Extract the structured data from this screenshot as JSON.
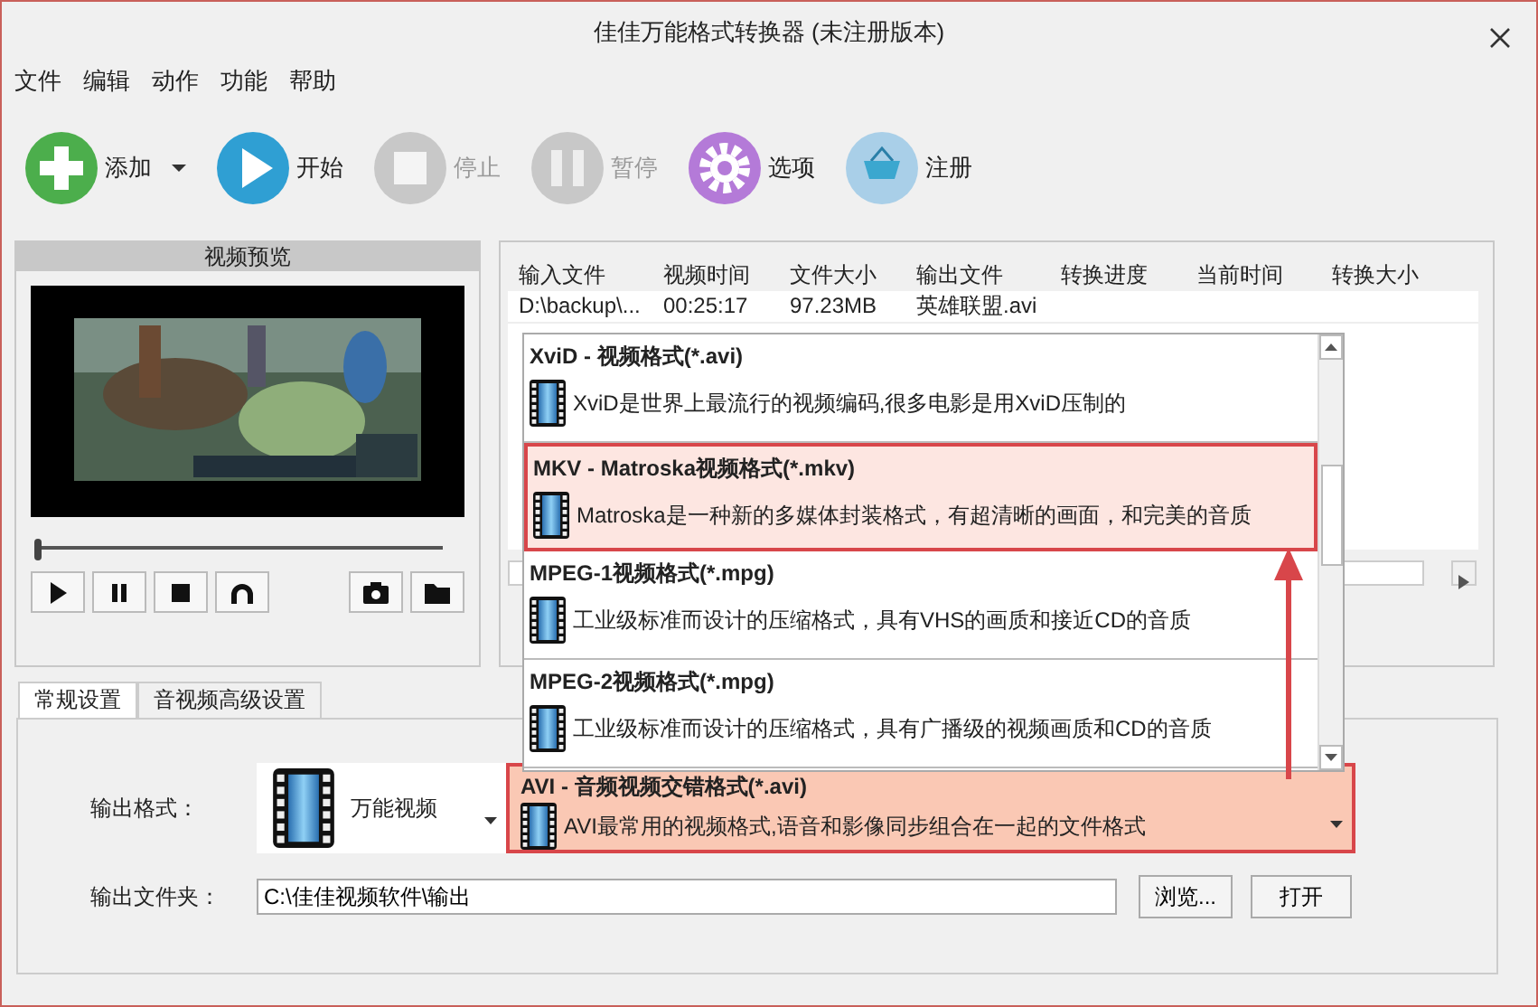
{
  "window": {
    "title": "佳佳万能格式转换器 (未注册版本)"
  },
  "menu": [
    "文件",
    "编辑",
    "动作",
    "功能",
    "帮助"
  ],
  "toolbar": [
    {
      "kind": "add",
      "label": "添加",
      "disabled": false,
      "dropdown": true
    },
    {
      "kind": "start",
      "label": "开始",
      "disabled": false,
      "dropdown": false
    },
    {
      "kind": "stop",
      "label": "停止",
      "disabled": true,
      "dropdown": false
    },
    {
      "kind": "pause",
      "label": "暂停",
      "disabled": true,
      "dropdown": false
    },
    {
      "kind": "options",
      "label": "选项",
      "disabled": false,
      "dropdown": false
    },
    {
      "kind": "register",
      "label": "注册",
      "disabled": false,
      "dropdown": false
    }
  ],
  "preview": {
    "title": "视频预览",
    "seek": {
      "level": 0
    },
    "controls": [
      {
        "kind": "play"
      },
      {
        "kind": "pause"
      },
      {
        "kind": "stop"
      },
      {
        "kind": "loop"
      },
      {
        "kind": "snapshot"
      },
      {
        "kind": "folder"
      }
    ]
  },
  "file_list": {
    "columns": [
      "输入文件",
      "视频时间",
      "文件大小",
      "输出文件",
      "转换进度",
      "当前时间",
      "转换大小"
    ],
    "rows": [
      [
        "D:\\backup\\...",
        "00:25:17",
        "97.23MB",
        "英雄联盟.avi"
      ]
    ]
  },
  "format_dropdown": {
    "items": [
      {
        "title": "XviD - 视频格式(*.avi)",
        "description": "XviD是世界上最流行的视频编码,很多电影是用XviD压制的",
        "highlighted": false
      },
      {
        "title": "MKV - Matroska视频格式(*.mkv)",
        "description": "Matroska是一种新的多媒体封装格式，有超清晰的画面，和完美的音质",
        "highlighted": true
      },
      {
        "title": "MPEG-1视频格式(*.mpg)",
        "description": "工业级标准而设计的压缩格式，具有VHS的画质和接近CD的音质",
        "highlighted": false
      },
      {
        "title": "MPEG-2视频格式(*.mpg)",
        "description": "工业级标准而设计的压缩格式，具有广播级的视频画质和CD的音质",
        "highlighted": false
      }
    ]
  },
  "tabs": [
    {
      "label": "常规设置",
      "selected": true
    },
    {
      "label": "音视频高级设置",
      "selected": false
    }
  ],
  "output_format": {
    "label": "输出格式：",
    "category": "万能视频",
    "format": {
      "title": "AVI - 音频视频交错格式(*.avi)",
      "description": "AVI最常用的视频格式,语音和影像同步组合在一起的文件格式",
      "highlighted": true
    }
  },
  "output_folder": {
    "label": "输出文件夹：",
    "value": "C:\\佳佳视频软件\\输出",
    "browse": "浏览...",
    "open": "打开"
  }
}
